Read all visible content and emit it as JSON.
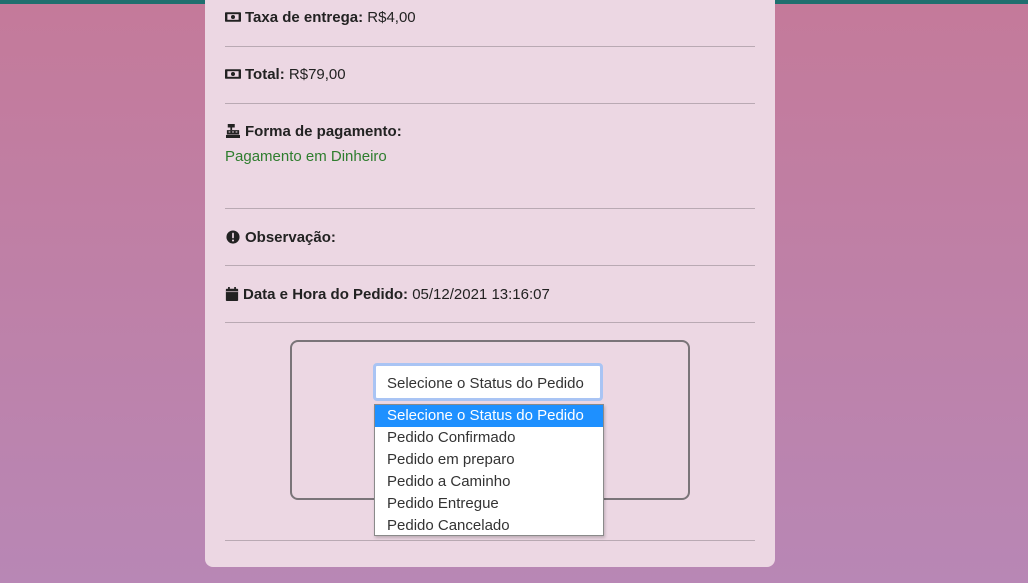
{
  "colors": {
    "card_bg": "#ecd7e3",
    "highlight": "#1e90ff",
    "payment_text": "#2e7d2e",
    "topbar": "#1f6f6f"
  },
  "details": {
    "delivery_fee_label": "Taxa de entrega:",
    "delivery_fee_value": "R$4,00",
    "total_label": "Total:",
    "total_value": "R$79,00",
    "payment_label": "Forma de pagamento:",
    "payment_value": "Pagamento em Dinheiro",
    "note_label": "Observação:",
    "date_label": "Data e Hora do Pedido:",
    "date_value": "05/12/2021 13:16:07"
  },
  "status_select": {
    "selected": "Selecione o Status do Pedido",
    "options": [
      "Selecione o Status do Pedido",
      "Pedido Confirmado",
      "Pedido em preparo",
      "Pedido a Caminho",
      "Pedido Entregue",
      "Pedido Cancelado"
    ]
  },
  "icons": {
    "delivery_fee": "money-bill-icon",
    "total": "money-bill-icon",
    "payment": "cash-register-icon",
    "note": "exclamation-circle-icon",
    "date": "calendar-icon"
  }
}
